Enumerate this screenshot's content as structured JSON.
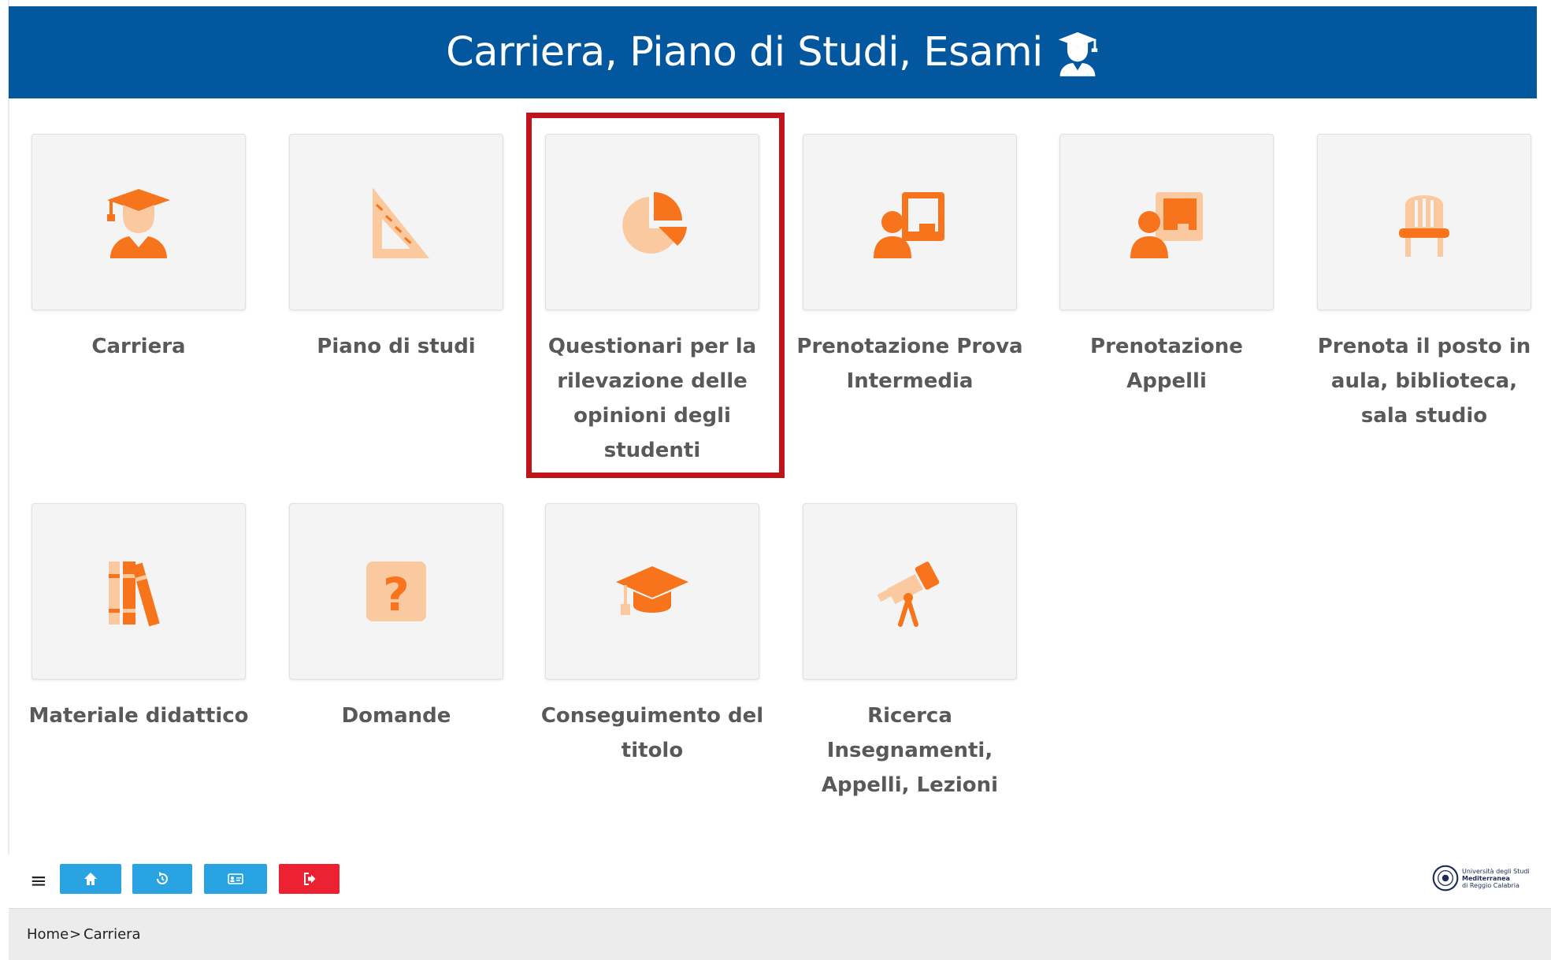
{
  "header": {
    "title": "Carriera, Piano di Studi, Esami",
    "icon": "student-graduate-icon"
  },
  "colors": {
    "header_bg": "#02579f",
    "icon_orange": "#f7741c",
    "icon_peach": "#fbc9a0",
    "label_gray": "#58595b",
    "highlight": "#c0141b",
    "btn_blue": "#2aa3e3",
    "btn_red": "#ec2233"
  },
  "tiles": [
    {
      "label": "Carriera",
      "icon": "student-graduate-icon"
    },
    {
      "label": "Piano di studi",
      "icon": "set-square-icon"
    },
    {
      "label": "Questionari per la rilevazione delle opinioni degli studenti",
      "icon": "pie-chart-icon"
    },
    {
      "label": "Prenotazione Prova Intermedia",
      "icon": "teacher-board-icon"
    },
    {
      "label": "Prenotazione Appelli",
      "icon": "presenter-board-icon"
    },
    {
      "label": "Prenota il posto in aula, biblioteca, sala studio",
      "icon": "chair-icon"
    },
    {
      "label": "Materiale didattico",
      "icon": "books-icon"
    },
    {
      "label": "Domande",
      "icon": "question-icon"
    },
    {
      "label": "Conseguimento del titolo",
      "icon": "graduation-cap-icon"
    },
    {
      "label": "Ricerca Insegnamenti, Appelli, Lezioni",
      "icon": "telescope-icon"
    }
  ],
  "footer": {
    "menu_icon": "≡",
    "buttons": [
      {
        "icon": "home-icon"
      },
      {
        "icon": "history-icon"
      },
      {
        "icon": "id-card-icon"
      },
      {
        "icon": "logout-icon"
      }
    ],
    "logo_text": [
      "Università degli Studi",
      "Mediterranea",
      "di Reggio Calabria"
    ]
  },
  "breadcrumb": {
    "home": "Home",
    "separator": ">",
    "current": "Carriera"
  }
}
